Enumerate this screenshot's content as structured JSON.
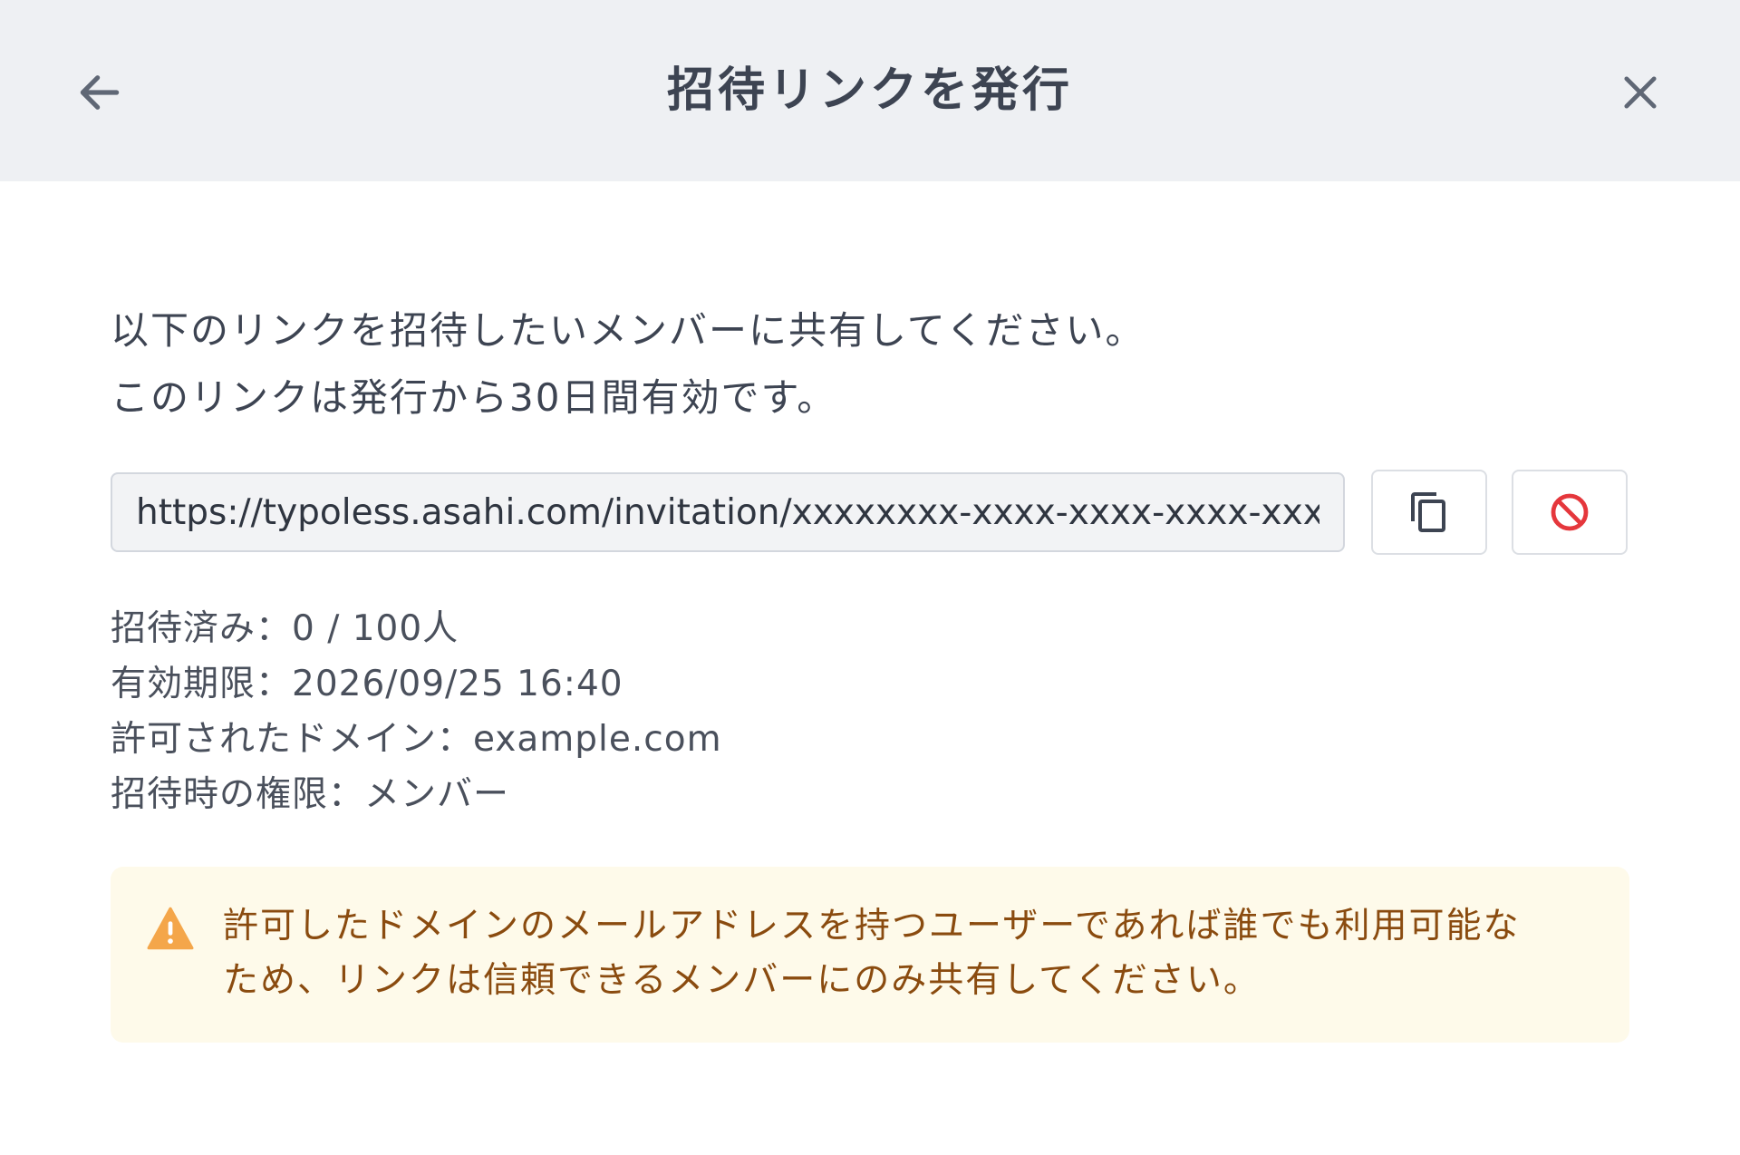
{
  "header": {
    "title": "招待リンクを発行",
    "back_icon": "arrow-left-icon",
    "close_icon": "close-icon"
  },
  "intro": {
    "line1": "以下のリンクを招待したいメンバーに共有してください。",
    "line2": "このリンクは発行から30日間有効です。"
  },
  "link": {
    "value": "https://typoless.asahi.com/invitation/xxxxxxxx-xxxx-xxxx-xxxx-xxxxxxxxxxxx",
    "copy_icon": "copy-icon",
    "revoke_icon": "block-icon"
  },
  "details": {
    "invited": "招待済み：0 / 100人",
    "expires": "有効期限：2026/09/25 16:40",
    "domain": "許可されたドメイン：example.com",
    "role": "招待時の権限：メンバー"
  },
  "warning": {
    "icon": "warning-triangle-icon",
    "line1": "許可したドメインのメールアドレスを持つユーザーであれば誰でも利用可能な",
    "line2": "ため、リンクは信頼できるメンバーにのみ共有してください。"
  },
  "colors": {
    "header_bg": "#eef0f3",
    "warning_bg": "#fefaea",
    "warning_text": "#8a4b0f",
    "warning_icon": "#f4a64a",
    "revoke_icon": "#e5373c"
  }
}
